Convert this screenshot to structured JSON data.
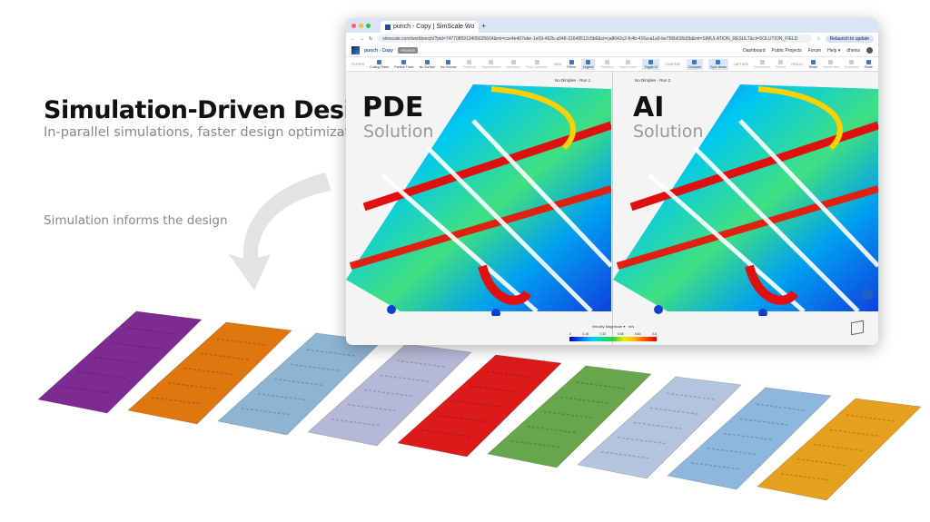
{
  "headline": "Simulation-Driven Design",
  "subhead": "In-parallel simulations, faster design optimizations",
  "annotation": "Simulation informs the design",
  "browser": {
    "tab_title": "punch - Copy | SimScale Wo",
    "url": "simscale.com/workbench/?pid=7477085913405635664&mi=cce4e407ebe-1e09-462b-a948-31649512c5b6&ci=ca8643c2-fc4b-416a-a1a9-be756b636d3b&mt=SIMULATION_RESULT&ct=SOLUTION_FIELD",
    "relaunch": "Relaunch to update"
  },
  "app": {
    "project": "punch - Copy",
    "private": "PRIVATE",
    "nav": [
      "Dashboard",
      "Public Projects",
      "Forum",
      "Help ▾",
      "dheins"
    ],
    "groups": {
      "filters": "FILTERS",
      "view": "VIEW",
      "compare": "COMPARE",
      "capture": "CAPTURE",
      "result": "RESULT"
    },
    "filters": [
      "Cutting Plane",
      "Particle Trace",
      "Iso Surface",
      "Iso Volume",
      "Threshold",
      "Displacement",
      "Animation",
      "Field Calculator"
    ],
    "view": [
      "Filters",
      "Legend",
      "Statistics",
      "Inspect point",
      "Toggle UI"
    ],
    "compare": [
      "Compare",
      "Sync views"
    ],
    "capture": [
      "Screenshot",
      "Record"
    ],
    "result": [
      "Reset",
      "Import view",
      "Download",
      "Share"
    ]
  },
  "viewer": {
    "left": {
      "run": "No Dimples - Run 1",
      "title": "PDE",
      "subtitle": "Solution"
    },
    "right": {
      "run": "No Dimples - Run 2",
      "title": "AI",
      "subtitle": "Solution"
    },
    "legend": {
      "field": "Velocity Magnitude",
      "unit": "m/s",
      "ticks": [
        "0",
        "0.16",
        "0.32",
        "0.48",
        "0.64",
        "0.8"
      ]
    }
  },
  "plates": {
    "colors": [
      "#7e2a93",
      "#e0760e",
      "#8eb4d4",
      "#b6b9d6",
      "#dd1a1a",
      "#67a64a",
      "#b2c5dc",
      "#8fb6de",
      "#e5a11e"
    ]
  }
}
